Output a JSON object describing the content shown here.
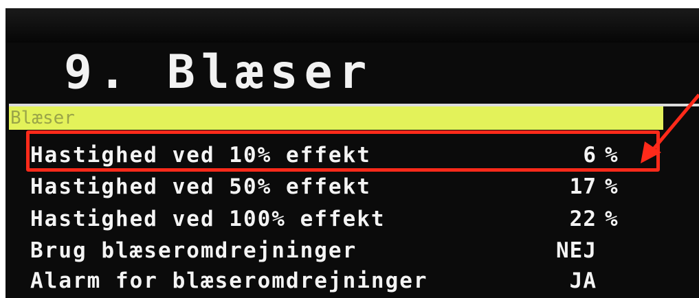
{
  "title": "9. Blæser",
  "highlighted_item": "Blæser",
  "rows": [
    {
      "label": "Hastighed ved 10% effekt",
      "value": "6",
      "unit": "%"
    },
    {
      "label": "Hastighed ved 50% effekt",
      "value": "17",
      "unit": "%"
    },
    {
      "label": "Hastighed ved 100% effekt",
      "value": "22",
      "unit": "%"
    },
    {
      "label": "Brug blæseromdrejninger",
      "value": "NEJ",
      "unit": ""
    },
    {
      "label": "Alarm for blæseromdrejninger",
      "value": "JA",
      "unit": ""
    }
  ],
  "colors": {
    "screen": "#0b0b0b",
    "text": "#f4f4f4",
    "highlight": "#e3f25a",
    "annotation": "#ff2a1a"
  }
}
